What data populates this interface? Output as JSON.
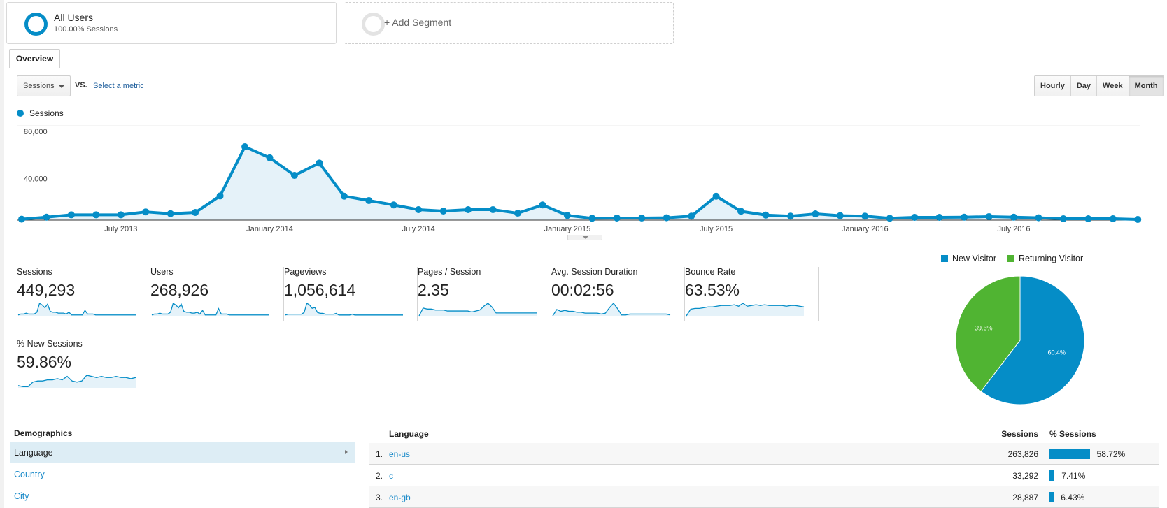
{
  "segments": {
    "all_users": {
      "title": "All Users",
      "subtitle": "100.00% Sessions"
    },
    "add_segment": {
      "label": "+ Add Segment"
    }
  },
  "tabs": [
    {
      "label": "Overview",
      "active": true
    }
  ],
  "metric_selector": {
    "selected": "Sessions",
    "vs_label": "VS.",
    "compare_link": "Select a metric"
  },
  "period_buttons": [
    {
      "label": "Hourly",
      "active": false
    },
    {
      "label": "Day",
      "active": false
    },
    {
      "label": "Week",
      "active": false
    },
    {
      "label": "Month",
      "active": true
    }
  ],
  "colors": {
    "accent": "#058dc7",
    "returning": "#50b432",
    "link": "#1a8ac9",
    "area_fill": "#e5f2f9"
  },
  "chart_data": [
    {
      "type": "area",
      "title": "",
      "legend": [
        {
          "name": "Sessions",
          "color": "#058dc7"
        }
      ],
      "legend_position": "top-left",
      "xlabel": "",
      "ylabel": "",
      "ylim": [
        0,
        80000
      ],
      "yticks": [
        40000,
        80000
      ],
      "ytick_labels": [
        "40,000",
        "80,000"
      ],
      "grid": true,
      "x_tick_labels": [
        {
          "label": "July 2013",
          "index": 4
        },
        {
          "label": "January 2014",
          "index": 10
        },
        {
          "label": "July 2014",
          "index": 16
        },
        {
          "label": "January 2015",
          "index": 22
        },
        {
          "label": "July 2015",
          "index": 28
        },
        {
          "label": "January 2016",
          "index": 34
        },
        {
          "label": "July 2016",
          "index": 40
        }
      ],
      "x": [
        "Mar 2013",
        "Apr 2013",
        "May 2013",
        "Jun 2013",
        "Jul 2013",
        "Aug 2013",
        "Sep 2013",
        "Oct 2013",
        "Nov 2013",
        "Dec 2013",
        "Jan 2014",
        "Feb 2014",
        "Mar 2014",
        "Apr 2014",
        "May 2014",
        "Jun 2014",
        "Jul 2014",
        "Aug 2014",
        "Sep 2014",
        "Oct 2014",
        "Nov 2014",
        "Dec 2014",
        "Jan 2015",
        "Feb 2015",
        "Mar 2015",
        "Apr 2015",
        "May 2015",
        "Jun 2015",
        "Jul 2015",
        "Aug 2015",
        "Sep 2015",
        "Oct 2015",
        "Nov 2015",
        "Dec 2015",
        "Jan 2016",
        "Feb 2016",
        "Mar 2016",
        "Apr 2016",
        "May 2016",
        "Jun 2016",
        "Jul 2016",
        "Aug 2016",
        "Sep 2016",
        "Oct 2016",
        "Nov 2016",
        "Dec 2016"
      ],
      "series": [
        {
          "name": "Sessions",
          "values": [
            800,
            2500,
            4500,
            4500,
            4500,
            7000,
            5500,
            6500,
            20500,
            62200,
            52900,
            37900,
            48400,
            20300,
            16600,
            12900,
            8900,
            7700,
            8900,
            8900,
            5900,
            12900,
            4000,
            1600,
            1800,
            1800,
            2000,
            3400,
            20300,
            7500,
            4300,
            3400,
            5300,
            3800,
            3400,
            1600,
            2400,
            2400,
            2500,
            3000,
            2500,
            2000,
            1200,
            1200,
            1200,
            600
          ]
        }
      ]
    },
    {
      "type": "pie",
      "title": "",
      "legend_position": "top",
      "categories": [
        "New Visitor",
        "Returning Visitor"
      ],
      "values": [
        60.4,
        39.6
      ],
      "labels": [
        "60.4%",
        "39.6%"
      ],
      "colors": [
        "#058dc7",
        "#50b432"
      ]
    }
  ],
  "metrics": [
    {
      "label": "Sessions",
      "value": "449,293",
      "spark": [
        1,
        2,
        2,
        3,
        2,
        2,
        2,
        4,
        14,
        12,
        9,
        13,
        5,
        4,
        4,
        3,
        3,
        3,
        2,
        4,
        1,
        1,
        1,
        1,
        1,
        6,
        2,
        2,
        2,
        1,
        1,
        1,
        1,
        1,
        1,
        1,
        1,
        1,
        1,
        1,
        1,
        1,
        1,
        1,
        1
      ]
    },
    {
      "label": "Users",
      "value": "268,926",
      "spark": [
        1,
        2,
        2,
        3,
        2,
        2,
        2,
        4,
        14,
        12,
        9,
        13,
        5,
        4,
        4,
        3,
        3,
        4,
        2,
        6,
        1,
        1,
        1,
        1,
        1,
        8,
        2,
        2,
        2,
        1,
        1,
        1,
        1,
        1,
        1,
        1,
        1,
        1,
        1,
        1,
        1,
        1,
        1,
        1,
        1
      ]
    },
    {
      "label": "Pageviews",
      "value": "1,056,614",
      "spark": [
        1,
        2,
        2,
        2,
        2,
        2,
        2,
        4,
        15,
        13,
        9,
        10,
        4,
        3,
        3,
        2,
        2,
        2,
        2,
        3,
        1,
        1,
        1,
        1,
        1,
        2,
        1,
        1,
        1,
        1,
        1,
        1,
        1,
        1,
        1,
        1,
        1,
        1,
        1,
        1,
        1,
        1,
        1,
        1,
        1
      ]
    },
    {
      "label": "Pages / Session",
      "value": "2.35",
      "spark": [
        0,
        8,
        7,
        7,
        6,
        6,
        6,
        5,
        5,
        5,
        5,
        5,
        5,
        4,
        5,
        6,
        10,
        13,
        9,
        3,
        3,
        3,
        3,
        3,
        3,
        3,
        3,
        3,
        3,
        3
      ]
    },
    {
      "label": "Avg. Session Duration",
      "value": "00:02:56",
      "spark": [
        0,
        7,
        5,
        6,
        5,
        5,
        4,
        4,
        3,
        3,
        3,
        3,
        2,
        3,
        9,
        14,
        8,
        1,
        1,
        2,
        2,
        2,
        2,
        2,
        2,
        2,
        2,
        2,
        2,
        1
      ]
    },
    {
      "label": "Bounce Rate",
      "value": "63.53%",
      "spark": [
        0,
        9,
        10,
        10,
        11,
        12,
        12,
        13,
        14,
        14,
        14,
        15,
        13,
        17,
        13,
        14,
        15,
        14,
        15,
        14,
        14,
        14,
        14,
        13,
        14,
        14,
        13,
        12
      ]
    },
    {
      "label": "% New Sessions",
      "value": "59.86%",
      "spark": [
        2,
        1,
        1,
        5,
        6,
        6,
        7,
        7,
        8,
        7,
        10,
        6,
        5,
        6,
        11,
        10,
        9,
        10,
        9,
        9,
        10,
        9,
        9,
        8,
        9
      ]
    }
  ],
  "demographics": {
    "header": "Demographics",
    "items": [
      {
        "label": "Language",
        "active": true
      },
      {
        "label": "Country",
        "active": false
      },
      {
        "label": "City",
        "active": false
      }
    ]
  },
  "language_table": {
    "columns": {
      "dimension": "Language",
      "sessions": "Sessions",
      "pct_sessions": "% Sessions"
    },
    "rows": [
      {
        "index": "1.",
        "language": "en-us",
        "sessions": "263,826",
        "pct": "58.72%",
        "pct_value": 58.72
      },
      {
        "index": "2.",
        "language": "c",
        "sessions": "33,292",
        "pct": "7.41%",
        "pct_value": 7.41
      },
      {
        "index": "3.",
        "language": "en-gb",
        "sessions": "28,887",
        "pct": "6.43%",
        "pct_value": 6.43
      }
    ]
  }
}
